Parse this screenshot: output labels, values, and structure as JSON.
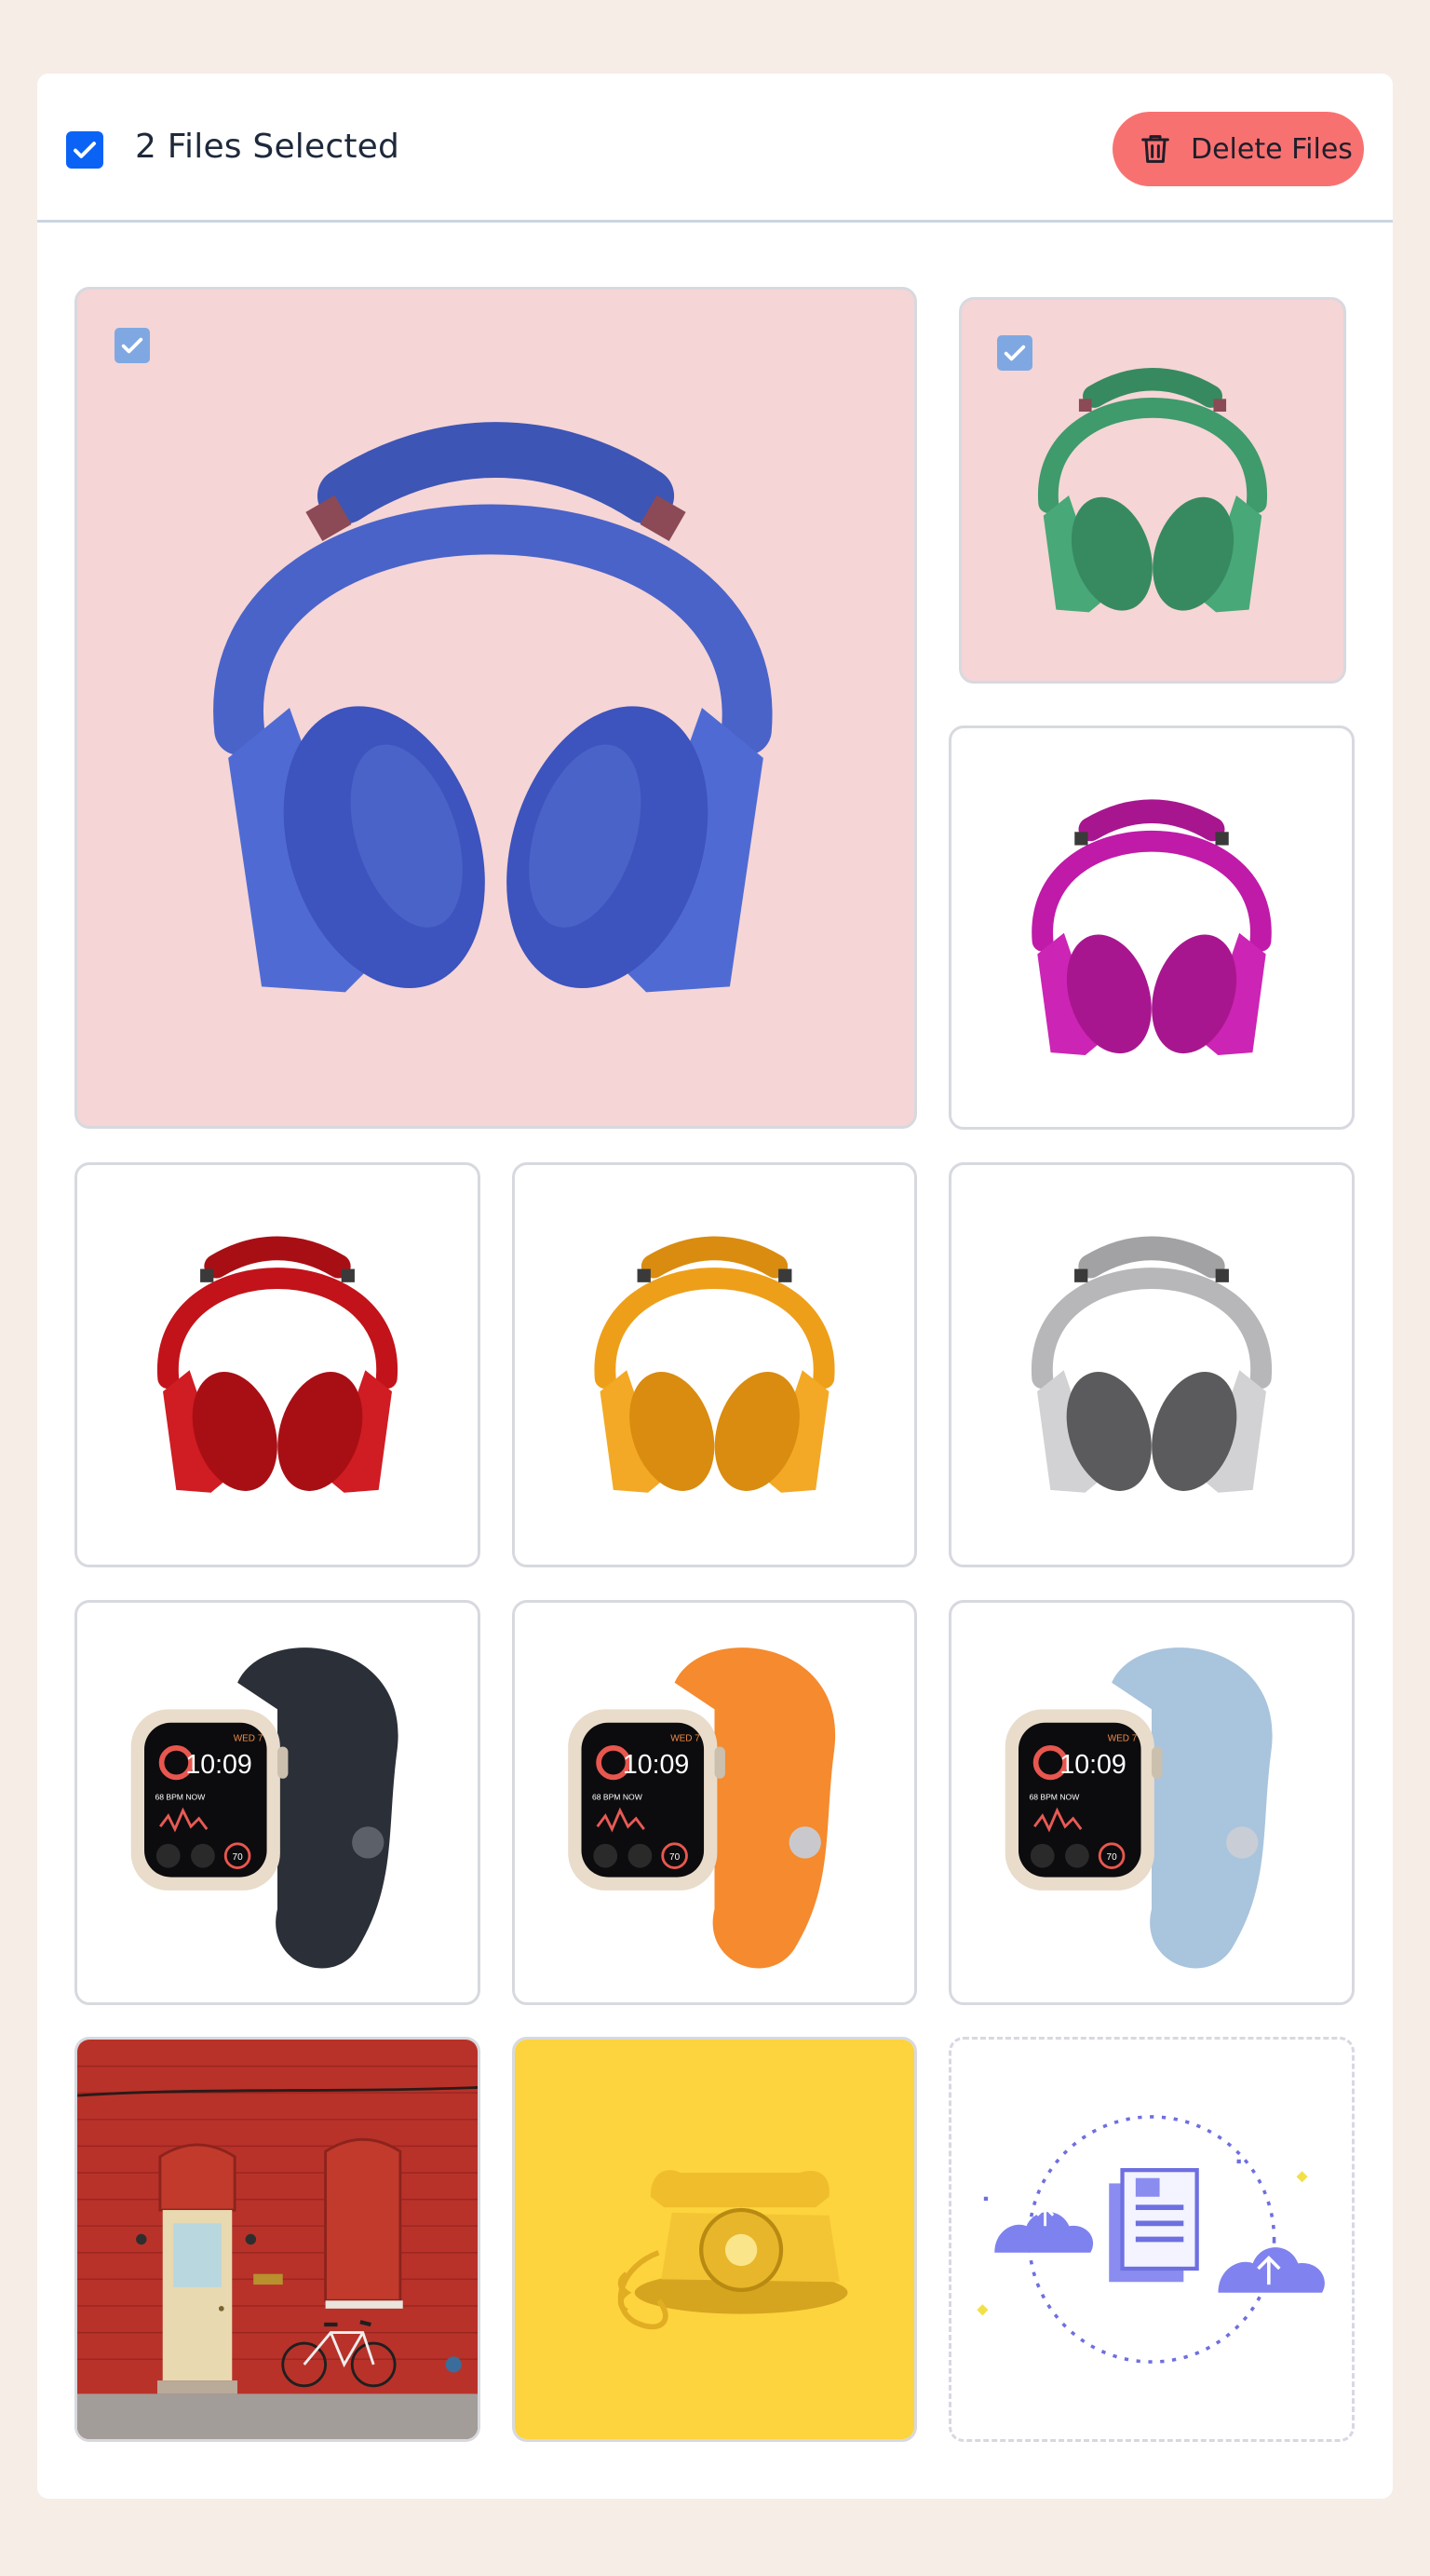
{
  "header": {
    "files_selected_label": "2 Files Selected",
    "select_all_checked": true,
    "delete_button_label": "Delete Files"
  },
  "colors": {
    "page_background": "#f6ede6",
    "checkbox_blue": "#0b63f6",
    "delete_button": "#f87171",
    "selected_tile_bg": "#f5d5d6",
    "tile_check_blue": "#7fa8e2"
  },
  "gallery": [
    {
      "subject": "headphones",
      "color": "#4a63c8",
      "selected": true
    },
    {
      "subject": "headphones",
      "color": "#3f9a6c",
      "selected": true
    },
    {
      "subject": "headphones",
      "color": "#c01aa8",
      "selected": false
    },
    {
      "subject": "headphones",
      "color": "#c2131a",
      "selected": false
    },
    {
      "subject": "headphones",
      "color": "#ee9f1a",
      "selected": false
    },
    {
      "subject": "headphones",
      "color": "#b7b7b9",
      "selected": false
    },
    {
      "subject": "watch",
      "band_color": "#2b2f38",
      "selected": false
    },
    {
      "subject": "watch",
      "band_color": "#f58a2e",
      "selected": false
    },
    {
      "subject": "watch",
      "band_color": "#a9c4dd",
      "selected": false
    },
    {
      "subject": "red-brick-building",
      "selected": false
    },
    {
      "subject": "yellow-rotary-telephone",
      "selected": false
    }
  ],
  "watch_face": {
    "time": "10:09",
    "day": "WED 7",
    "bpm": "68 BPM NOW",
    "complication": "70"
  },
  "upload": {
    "icon": "cloud-upload-icon"
  }
}
